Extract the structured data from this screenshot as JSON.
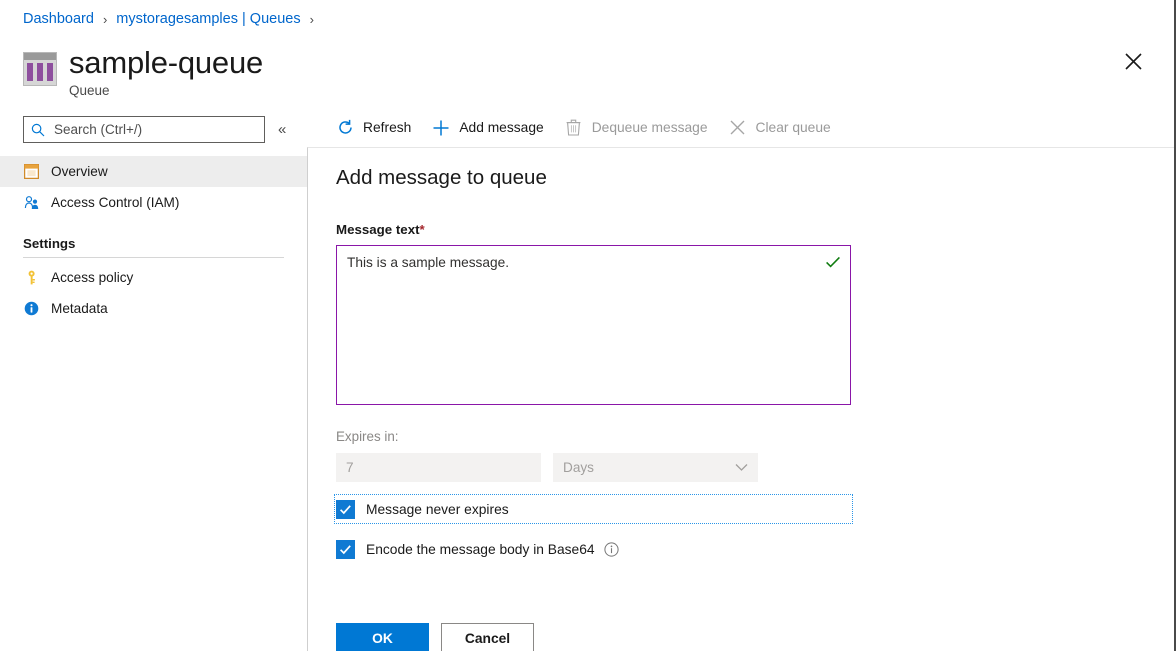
{
  "breadcrumb": {
    "items": [
      {
        "label": "Dashboard"
      },
      {
        "label": "mystoragesamples | Queues"
      }
    ],
    "separator": "›"
  },
  "header": {
    "title": "sample-queue",
    "subtitle": "Queue",
    "icon": "queue-icon",
    "close_icon": "close-icon"
  },
  "sidebar": {
    "search": {
      "placeholder": "Search (Ctrl+/)",
      "value": "",
      "icon": "search-icon"
    },
    "collapse_icon": "«",
    "items": [
      {
        "label": "Overview",
        "icon": "overview-icon",
        "selected": true
      },
      {
        "label": "Access Control (IAM)",
        "icon": "people-icon",
        "selected": false
      }
    ],
    "section": {
      "label": "Settings",
      "items": [
        {
          "label": "Access policy",
          "icon": "key-icon"
        },
        {
          "label": "Metadata",
          "icon": "info-icon"
        }
      ]
    }
  },
  "toolbar": {
    "buttons": [
      {
        "label": "Refresh",
        "icon": "refresh-icon",
        "disabled": false
      },
      {
        "label": "Add message",
        "icon": "plus-icon",
        "disabled": false
      },
      {
        "label": "Dequeue message",
        "icon": "trash-icon",
        "disabled": true
      },
      {
        "label": "Clear queue",
        "icon": "x-icon",
        "disabled": true
      }
    ]
  },
  "dialog": {
    "title": "Add message to queue",
    "message_field": {
      "label": "Message text",
      "required_marker": "*",
      "value": "This is a sample message.",
      "valid_icon": "checkmark-icon",
      "border_color": "#8a16a8"
    },
    "expires": {
      "label": "Expires in:",
      "amount_value": "7",
      "unit_value": "Days",
      "chevron_icon": "chevron-down-icon",
      "disabled": true
    },
    "checkboxes": [
      {
        "label": "Message never expires",
        "checked": true,
        "focused": true,
        "has_info": false
      },
      {
        "label": "Encode the message body in Base64",
        "checked": true,
        "focused": false,
        "has_info": true,
        "info_icon": "info-circle-icon"
      }
    ],
    "buttons": {
      "ok_label": "OK",
      "cancel_label": "Cancel",
      "accent_color": "#0078d4"
    }
  }
}
